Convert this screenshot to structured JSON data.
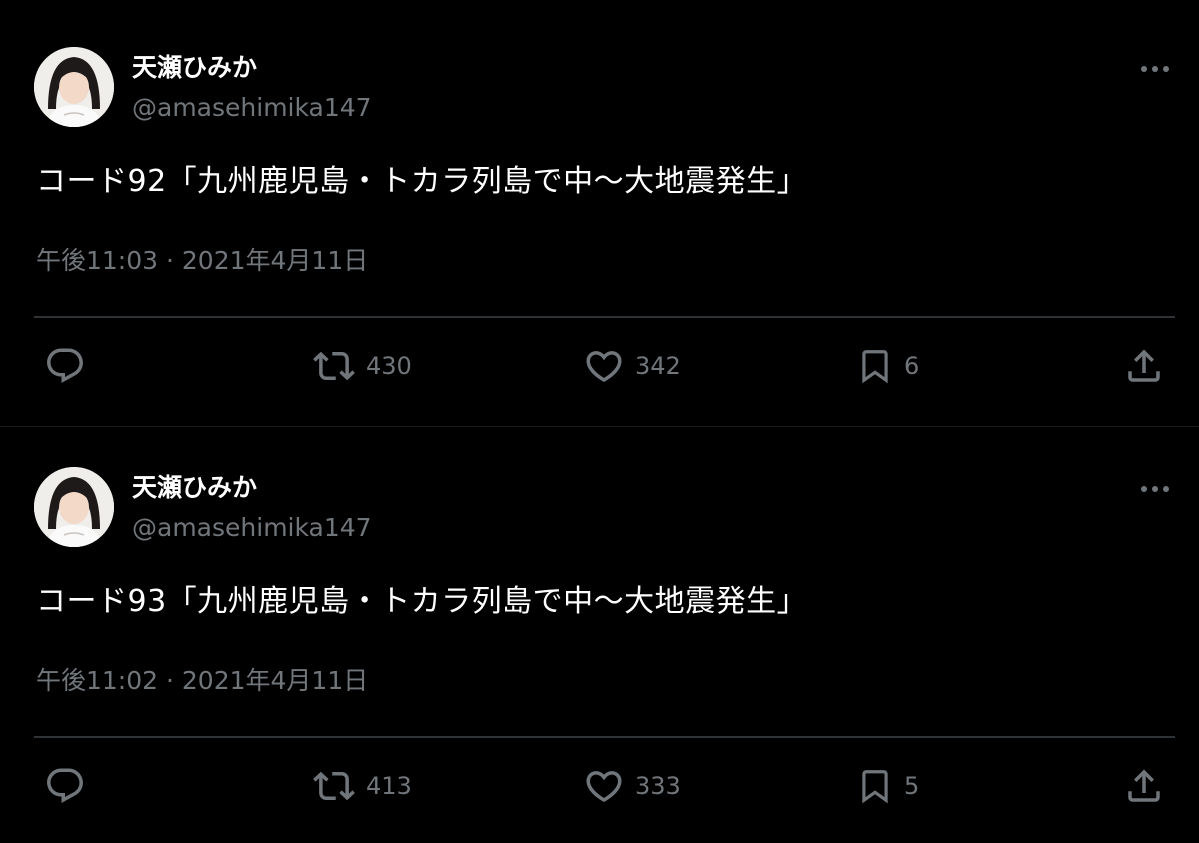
{
  "tweets": [
    {
      "author_name": "天瀬ひみか",
      "author_handle": "@amasehimika147",
      "text": "コード92「九州鹿児島・トカラ列島で中〜大地震発生」",
      "timestamp": "午後11:03 · 2021年4月11日",
      "retweets": "430",
      "likes": "342",
      "bookmarks": "6"
    },
    {
      "author_name": "天瀬ひみか",
      "author_handle": "@amasehimika147",
      "text": "コード93「九州鹿児島・トカラ列島で中〜大地震発生」",
      "timestamp": "午後11:02 · 2021年4月11日",
      "retweets": "413",
      "likes": "333",
      "bookmarks": "5"
    }
  ],
  "icons": {
    "more": "more-horizontal-icon",
    "reply": "reply-icon",
    "retweet": "retweet-icon",
    "like": "heart-icon",
    "bookmark": "bookmark-icon",
    "share": "share-icon"
  },
  "colors": {
    "background": "#000000",
    "primary_text": "#ffffff",
    "secondary_text": "#71767b",
    "divider": "#2f3336"
  }
}
